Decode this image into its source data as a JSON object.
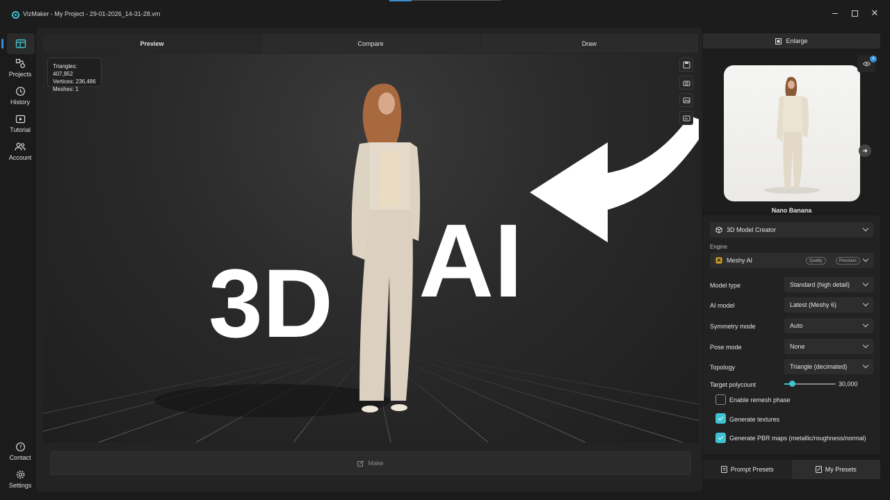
{
  "window": {
    "title": "VizMaker - My Project - 29-01-2026_14-31-28.vm"
  },
  "nav": {
    "items": [
      {
        "label": "Projects"
      },
      {
        "label": "History"
      },
      {
        "label": "Tutorial"
      },
      {
        "label": "Account"
      }
    ],
    "bottom": [
      {
        "label": "Contact"
      },
      {
        "label": "Settings"
      }
    ]
  },
  "tabs": [
    {
      "label": "Preview",
      "active": true
    },
    {
      "label": "Compare",
      "active": false
    },
    {
      "label": "Draw",
      "active": false
    }
  ],
  "stats": {
    "triangles": "Triangles: 407,952",
    "vertices": "Vertices: 236,486",
    "meshes": "Meshes: 1"
  },
  "overlay": {
    "text_3d": "3D",
    "text_ai": "AI"
  },
  "make": {
    "label": "Make"
  },
  "right": {
    "enlarge_label": "Enlarge",
    "badge_count": "4",
    "preview_caption": "Nano Banana",
    "mode": "3D Model Creator",
    "engine_label": "Engine",
    "engine": {
      "name": "Meshy AI",
      "tags": [
        "Quality",
        "Precision"
      ]
    },
    "fields": [
      {
        "label": "Model type",
        "value": "Standard (high detail)"
      },
      {
        "label": "AI model",
        "value": "Latest (Meshy 6)"
      },
      {
        "label": "Symmetry mode",
        "value": "Auto"
      },
      {
        "label": "Pose mode",
        "value": "None"
      },
      {
        "label": "Topology",
        "value": "Triangle (decimated)"
      }
    ],
    "polycount": {
      "label": "Target polycount",
      "value": "30,000",
      "fraction": 0.15
    },
    "checks": [
      {
        "label": "Enable remesh phase",
        "checked": false
      },
      {
        "label": "Generate textures",
        "checked": true
      },
      {
        "label": "Generate PBR maps (metallic/roughness/normal)",
        "checked": true
      }
    ],
    "bottom_tabs": [
      {
        "label": "Prompt Presets"
      },
      {
        "label": "My Presets"
      }
    ]
  },
  "colors": {
    "accent": "#3fc3d0",
    "highlight": "#3a8fd6"
  }
}
